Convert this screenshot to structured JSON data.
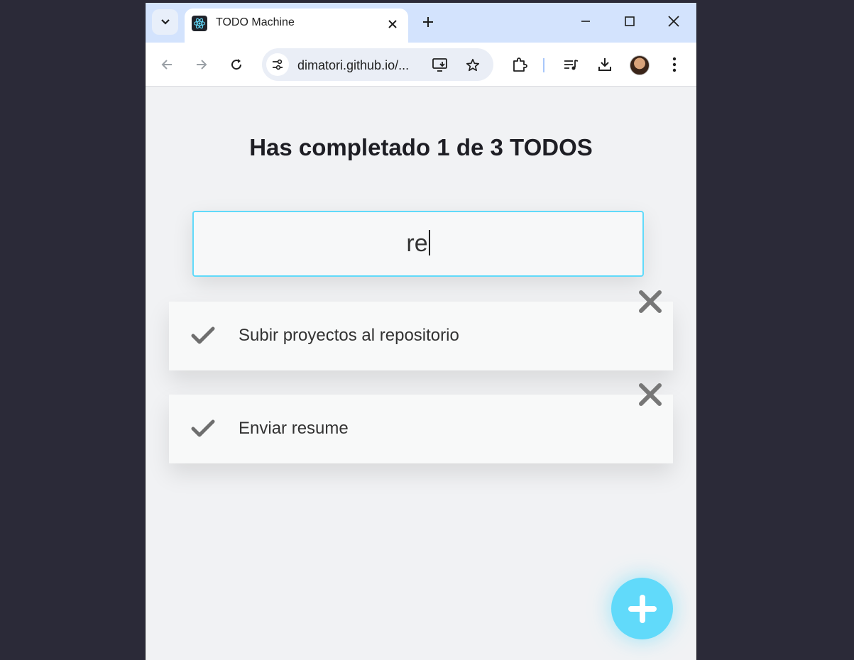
{
  "browser": {
    "tab_title": "TODO Machine",
    "url": "dimatori.github.io/..."
  },
  "app": {
    "counter": {
      "prefix": "Has completado",
      "completed": "1",
      "middle": "de",
      "total": "3",
      "suffix": "TODOS"
    },
    "search": {
      "value": "re"
    },
    "todos": [
      {
        "text": "Subir proyectos al repositorio"
      },
      {
        "text": "Enviar resume"
      }
    ]
  },
  "colors": {
    "accent": "#61dafa",
    "check": "#6e6e6e",
    "delete": "#777777"
  },
  "icons": {
    "add_button": "plus-icon",
    "complete": "check-icon",
    "delete": "close-icon"
  }
}
